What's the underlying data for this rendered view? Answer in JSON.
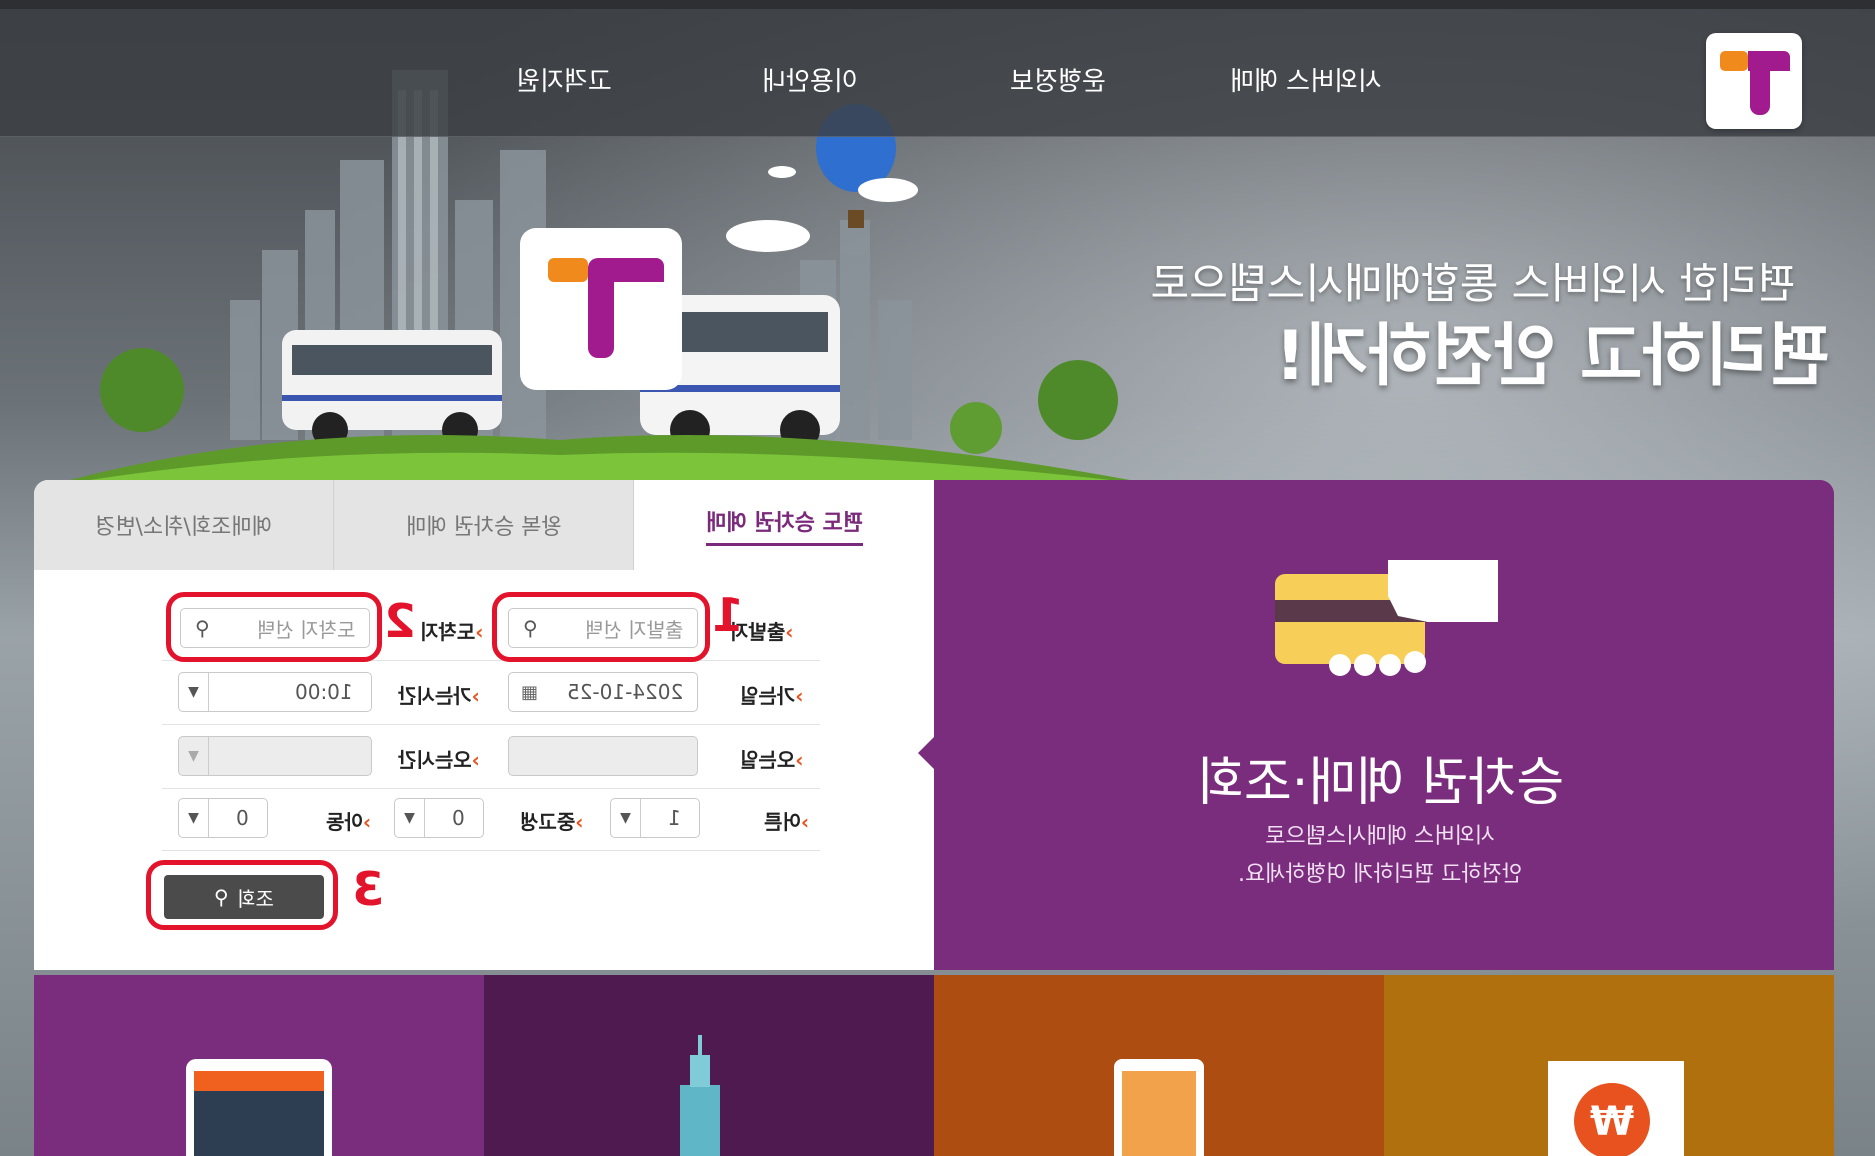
{
  "header": {
    "nav": [
      {
        "label": "시외버스 예매"
      },
      {
        "label": "운행정보"
      },
      {
        "label": "이용안내"
      },
      {
        "label": "고객지원"
      }
    ],
    "logo_icon": "t-logo-icon"
  },
  "hero": {
    "line1": "편리한 시외버스 통합예매시스템으로",
    "line2": "편리하고 안전하게!"
  },
  "booking": {
    "tabs": [
      {
        "label": "편도 승차권 예매",
        "active": true
      },
      {
        "label": "왕복 승차권 예매",
        "active": false
      },
      {
        "label": "예매조회/취소/변경",
        "active": false
      }
    ],
    "departure": {
      "label": "출발지",
      "placeholder": "출발지 선택"
    },
    "arrival": {
      "label": "도착지",
      "placeholder": "도착지 선택"
    },
    "go_date": {
      "label": "가는일",
      "value": "2024-10-25"
    },
    "go_time": {
      "label": "가는시간",
      "value": "10:00"
    },
    "return_date": {
      "label": "오는일",
      "value": ""
    },
    "return_time": {
      "label": "오는시간",
      "value": ""
    },
    "adult": {
      "label": "어른",
      "value": "1"
    },
    "student": {
      "label": "중고생",
      "value": "0"
    },
    "child": {
      "label": "아동",
      "value": "0"
    },
    "search_label": "조회",
    "annotations": [
      "1",
      "2",
      "3"
    ]
  },
  "info": {
    "title": "승차권 예매·조회",
    "sub1": "시외버스 예매시스템으로",
    "sub2": "안전하고 편리하게 여행하세요."
  },
  "colors": {
    "purple": "#7a2c7d",
    "dark_purple": "#4e1a50",
    "orange": "#ad4d12",
    "amber": "#b0700e",
    "red_annotation": "#e3132b",
    "logo_orange": "#f08a1c",
    "logo_magenta": "#a21b8e"
  }
}
